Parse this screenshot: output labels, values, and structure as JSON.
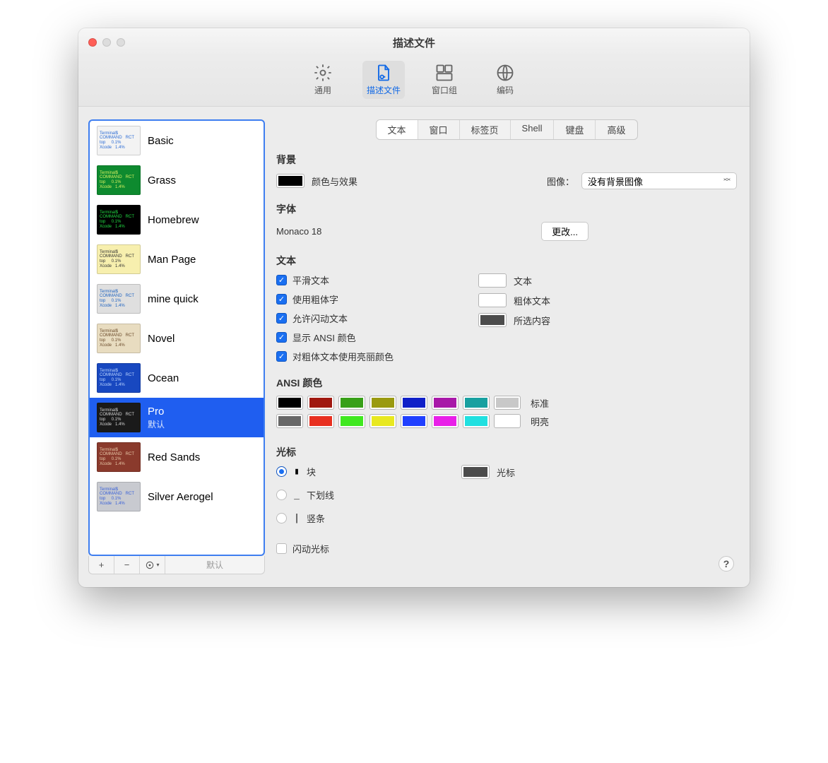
{
  "window": {
    "title": "描述文件"
  },
  "toolbar": {
    "items": [
      {
        "label": "通用"
      },
      {
        "label": "描述文件"
      },
      {
        "label": "窗口组"
      },
      {
        "label": "编码"
      }
    ],
    "active_index": 1
  },
  "sidebar": {
    "profiles": [
      {
        "name": "Basic",
        "default": false,
        "thumb_bg": "#f3f3f3",
        "thumb_fg": "#2a6bd4"
      },
      {
        "name": "Grass",
        "default": false,
        "thumb_bg": "#0e8a2f",
        "thumb_fg": "#d8f060"
      },
      {
        "name": "Homebrew",
        "default": false,
        "thumb_bg": "#000000",
        "thumb_fg": "#22dd44"
      },
      {
        "name": "Man Page",
        "default": false,
        "thumb_bg": "#f7efae",
        "thumb_fg": "#333333"
      },
      {
        "name": "mine quick",
        "default": false,
        "thumb_bg": "#dfdfdf",
        "thumb_fg": "#2064c0"
      },
      {
        "name": "Novel",
        "default": false,
        "thumb_bg": "#e8dcc0",
        "thumb_fg": "#6a4a2a"
      },
      {
        "name": "Ocean",
        "default": false,
        "thumb_bg": "#1848c0",
        "thumb_fg": "#bcd6ff"
      },
      {
        "name": "Pro",
        "default": true,
        "thumb_bg": "#1a1a1a",
        "thumb_fg": "#d8d8d8"
      },
      {
        "name": "Red Sands",
        "default": false,
        "thumb_bg": "#8a3a2c",
        "thumb_fg": "#e8c8a8"
      },
      {
        "name": "Silver Aerogel",
        "default": false,
        "thumb_bg": "#c8cad0",
        "thumb_fg": "#3860d8"
      }
    ],
    "selected_index": 7,
    "default_label": "默认",
    "bottom": {
      "add": "+",
      "remove": "−",
      "more": "⊙",
      "default_btn": "默认"
    }
  },
  "subtabs": {
    "items": [
      "文本",
      "窗口",
      "标签页",
      "Shell",
      "键盘",
      "高级"
    ],
    "active_index": 0
  },
  "background": {
    "title": "背景",
    "color_label": "颜色与效果",
    "color": "#000000",
    "image_label": "图像：",
    "image_select": "没有背景图像"
  },
  "font": {
    "title": "字体",
    "name": "Monaco 18",
    "change_btn": "更改..."
  },
  "text": {
    "title": "文本",
    "checks": [
      {
        "label": "平滑文本",
        "checked": true
      },
      {
        "label": "使用粗体字",
        "checked": true
      },
      {
        "label": "允许闪动文本",
        "checked": true
      },
      {
        "label": "显示 ANSI 颜色",
        "checked": true
      },
      {
        "label": "对粗体文本使用亮丽颜色",
        "checked": true
      }
    ],
    "color_labels": {
      "text": "文本",
      "bold": "粗体文本",
      "selection": "所选内容"
    },
    "colors": {
      "text": "#ffffff",
      "bold": "#ffffff",
      "selection": "#4c4c4c"
    }
  },
  "ansi": {
    "title": "ANSI 颜色",
    "labels": {
      "normal": "标准",
      "bright": "明亮"
    },
    "normal": [
      "#000000",
      "#a01810",
      "#38a018",
      "#9a9a10",
      "#1020c8",
      "#a818a8",
      "#18a0a0",
      "#c8c8c8"
    ],
    "bright": [
      "#686868",
      "#e83020",
      "#40e820",
      "#e8e820",
      "#2040ff",
      "#e820e8",
      "#20e0e0",
      "#ffffff"
    ]
  },
  "cursor": {
    "title": "光标",
    "options": [
      {
        "label": "块",
        "glyph": "▮",
        "selected": true
      },
      {
        "label": "下划线",
        "glyph": "_",
        "selected": false
      },
      {
        "label": "竖条",
        "glyph": "|",
        "selected": false
      }
    ],
    "blink_label": "闪动光标",
    "blink_checked": false,
    "color_label": "光标",
    "color": "#4c4c4c"
  }
}
